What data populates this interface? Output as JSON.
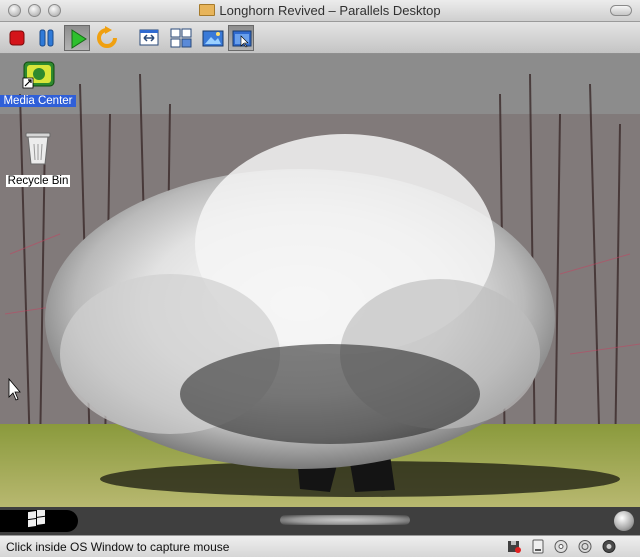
{
  "window": {
    "title": "Longhorn Revived – Parallels Desktop"
  },
  "toolbar": {
    "buttons": [
      {
        "name": "stop-icon"
      },
      {
        "name": "pause-icon"
      },
      {
        "name": "play-icon",
        "pressed": true
      },
      {
        "name": "restart-icon"
      },
      {
        "name": "fit-window-icon"
      },
      {
        "name": "full-screen-icon"
      },
      {
        "name": "screenshot-icon"
      },
      {
        "name": "capture-input-icon",
        "pressed": true
      }
    ]
  },
  "desktop": {
    "icons": [
      {
        "label": "Media Center",
        "icon": "media-center-icon",
        "selected": true
      },
      {
        "label": "Recycle Bin",
        "icon": "recycle-bin-icon",
        "selected": false
      }
    ]
  },
  "taskbar": {
    "start_icon": "windows-logo-icon",
    "tray_icon": "orb-icon"
  },
  "statusbar": {
    "message": "Click inside OS Window to capture mouse",
    "device_icons": [
      "floppy-icon",
      "hdd-icon",
      "cdrom-icon",
      "network-icon",
      "sound-icon"
    ]
  },
  "colors": {
    "desktop_sky": "#8d8d8d",
    "foliage": "#e6e6e6",
    "grass": "#a8b35a",
    "selection": "#2f5fd8"
  }
}
